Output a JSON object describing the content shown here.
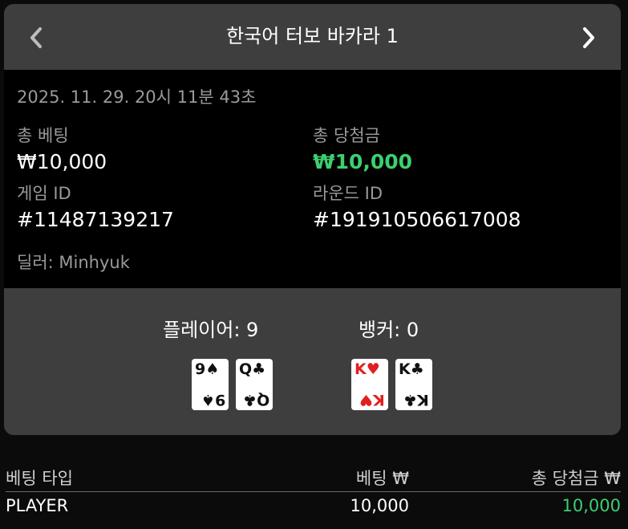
{
  "header": {
    "title": "한국어 터보 바카라 1",
    "prev_icon": "chevron-left-icon",
    "next_icon": "chevron-right-icon"
  },
  "details": {
    "timestamp": "2025. 11. 29. 20시 11분 43초",
    "total_bet_label": "총 베팅",
    "total_bet_value": "₩10,000",
    "total_win_label": "총 당첨금",
    "total_win_value": "₩10,000",
    "game_id_label": "게임 ID",
    "game_id_value": "#11487139217",
    "round_id_label": "라운드 ID",
    "round_id_value": "#191910506617008",
    "dealer": "딜러: Minhyuk"
  },
  "result": {
    "player_label": "플레이어: 9",
    "banker_label": "뱅커: 0",
    "player_cards": [
      {
        "rank": "9",
        "suit": "♠",
        "color": "black"
      },
      {
        "rank": "Q",
        "suit": "♣",
        "color": "black"
      }
    ],
    "banker_cards": [
      {
        "rank": "K",
        "suit": "♥",
        "color": "red"
      },
      {
        "rank": "K",
        "suit": "♣",
        "color": "black"
      }
    ]
  },
  "table": {
    "headers": [
      "베팅 타입",
      "베팅 ₩",
      "총 당첨금 ₩"
    ],
    "rows": [
      {
        "bet_type": "PLAYER",
        "bet": "10,000",
        "win": "10,000"
      }
    ]
  },
  "colors": {
    "win_green": "#3ccf6e",
    "panel_bg": "#3e3e3e",
    "info_bg": "#000000",
    "card_red": "#e0201f"
  }
}
